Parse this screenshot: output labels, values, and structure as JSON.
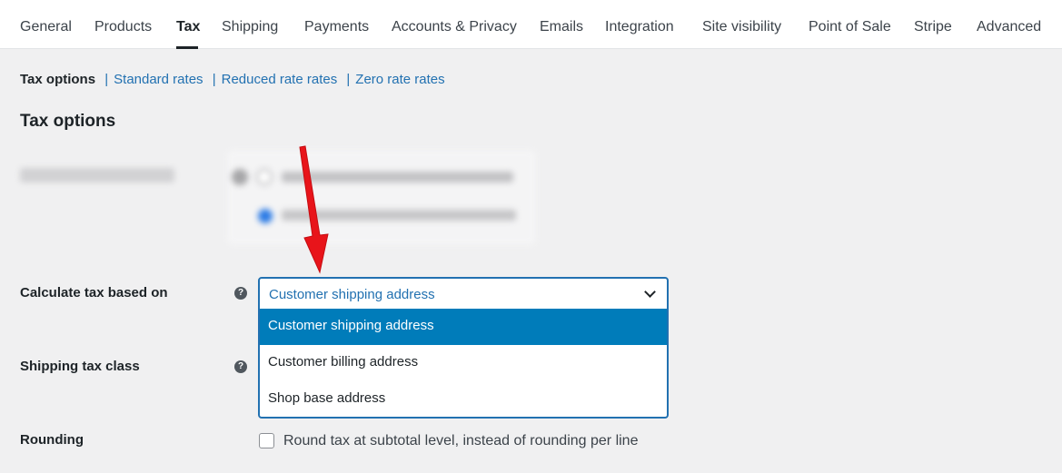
{
  "tabs": [
    {
      "label": "General"
    },
    {
      "label": "Products"
    },
    {
      "label": "Tax",
      "active": true
    },
    {
      "label": "Shipping"
    },
    {
      "label": "Payments"
    },
    {
      "label": "Accounts & Privacy"
    },
    {
      "label": "Emails"
    },
    {
      "label": "Integration"
    },
    {
      "label": "Site visibility"
    },
    {
      "label": "Point of Sale"
    },
    {
      "label": "Stripe"
    },
    {
      "label": "Advanced"
    }
  ],
  "subnav": {
    "current": "Tax options",
    "separator": "|",
    "links": [
      "Standard rates",
      "Reduced rate rates",
      "Zero rate rates"
    ]
  },
  "section_title": "Tax options",
  "fields": {
    "calculate_tax": {
      "label": "Calculate tax based on",
      "help": "?",
      "selected": "Customer shipping address",
      "options": [
        {
          "label": "Customer shipping address",
          "highlighted": true
        },
        {
          "label": "Customer billing address"
        },
        {
          "label": "Shop base address"
        }
      ]
    },
    "shipping_tax_class": {
      "label": "Shipping tax class",
      "help": "?"
    },
    "rounding": {
      "label": "Rounding",
      "checkbox_label": "Round tax at subtotal level, instead of rounding per line",
      "checked": false
    }
  },
  "colors": {
    "link": "#2271b1",
    "highlight": "#007cba",
    "annotation_arrow": "#e8141a"
  },
  "icons": {
    "help": "question-circle-icon",
    "chevron": "chevron-down-icon",
    "annotation": "red-arrow-annotation"
  }
}
